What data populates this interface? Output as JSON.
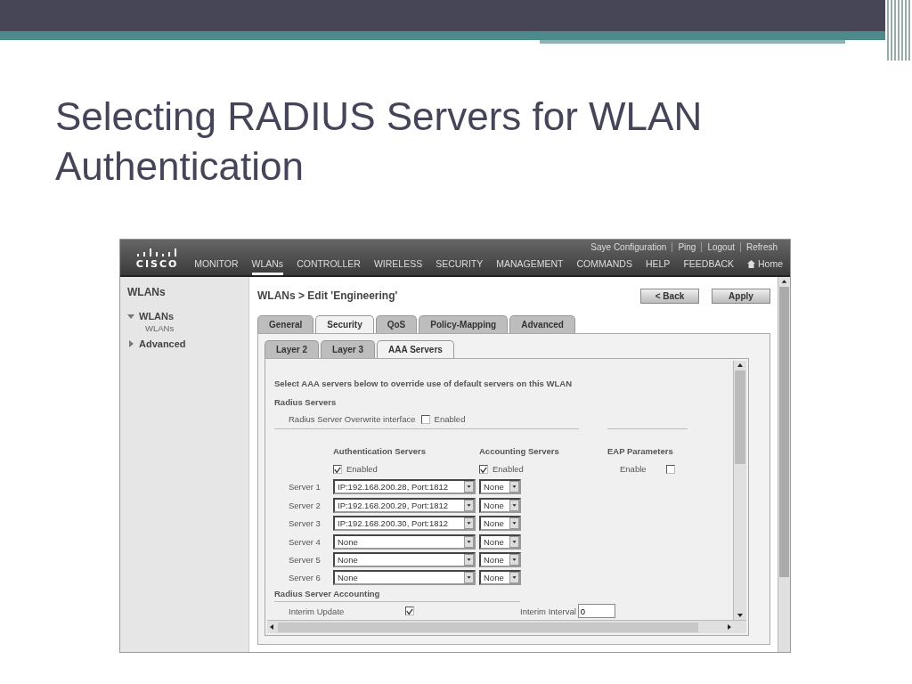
{
  "slide": {
    "title_lines": [
      "Selecting RADIUS Servers for WLAN",
      "Authentication"
    ]
  },
  "screenshot": {
    "header": {
      "logo": "CISCO",
      "top_links": [
        "Saye Configuration",
        "Ping",
        "Logout",
        "Refresh"
      ],
      "nav": [
        {
          "label": "MONITOR",
          "selected": false
        },
        {
          "label": "WLANs",
          "selected": true
        },
        {
          "label": "CONTROLLER",
          "selected": false
        },
        {
          "label": "WIRELESS",
          "selected": false
        },
        {
          "label": "SECURITY",
          "selected": false
        },
        {
          "label": "MANAGEMENT",
          "selected": false
        },
        {
          "label": "COMMANDS",
          "selected": false
        },
        {
          "label": "HELP",
          "selected": false
        },
        {
          "label": "FEEDBACK",
          "selected": false
        }
      ],
      "home": "Home"
    },
    "sidebar": {
      "title": "WLANs",
      "items": [
        {
          "label": "WLANs",
          "expanded": true,
          "children": [
            {
              "label": "WLANs"
            }
          ]
        },
        {
          "label": "Advanced",
          "expanded": false
        }
      ]
    },
    "page": {
      "breadcrumb": "WLANs > Edit  'Engineering'",
      "buttons": [
        "< Back",
        "Apply"
      ],
      "tabs": [
        {
          "label": "General",
          "selected": false
        },
        {
          "label": "Security",
          "selected": true
        },
        {
          "label": "QoS",
          "selected": false
        },
        {
          "label": "Policy-Mapping",
          "selected": false
        },
        {
          "label": "Advanced",
          "selected": false
        }
      ],
      "subtabs": [
        {
          "label": "Layer 2",
          "selected": false
        },
        {
          "label": "Layer 3",
          "selected": false
        },
        {
          "label": "AAA Servers",
          "selected": true
        }
      ],
      "intro": "Select AAA servers below to override use of default servers on this WLAN",
      "radius_heading": "Radius Servers",
      "overwrite": {
        "label": "Radius Server Overwrite interface",
        "checkbox_label": "Enabled",
        "checked": false
      },
      "auth_heading": "Authentication Servers",
      "auth_enabled": {
        "label": "Enabled",
        "checked": true
      },
      "acct_heading": "Accounting Servers",
      "acct_enabled": {
        "label": "Enabled",
        "checked": true
      },
      "eap_heading": "EAP Parameters",
      "eap_enable": {
        "label": "Enable",
        "checked": false
      },
      "servers": [
        {
          "label": "Server 1",
          "auth": "IP:192.168.200.28, Port:1812",
          "acct": "None"
        },
        {
          "label": "Server 2",
          "auth": "IP:192.168.200.29, Port:1812",
          "acct": "None"
        },
        {
          "label": "Server 3",
          "auth": "IP:192.168.200.30, Port:1812",
          "acct": "None"
        },
        {
          "label": "Server 4",
          "auth": "None",
          "acct": "None"
        },
        {
          "label": "Server 5",
          "auth": "None",
          "acct": "None"
        },
        {
          "label": "Server 6",
          "auth": "None",
          "acct": "None"
        }
      ],
      "accounting_heading": "Radius Server Accounting",
      "interim_update": {
        "label": "Interim Update",
        "checked": true
      },
      "interim_interval": {
        "label": "Interim Interval",
        "value": "0"
      }
    }
  }
}
